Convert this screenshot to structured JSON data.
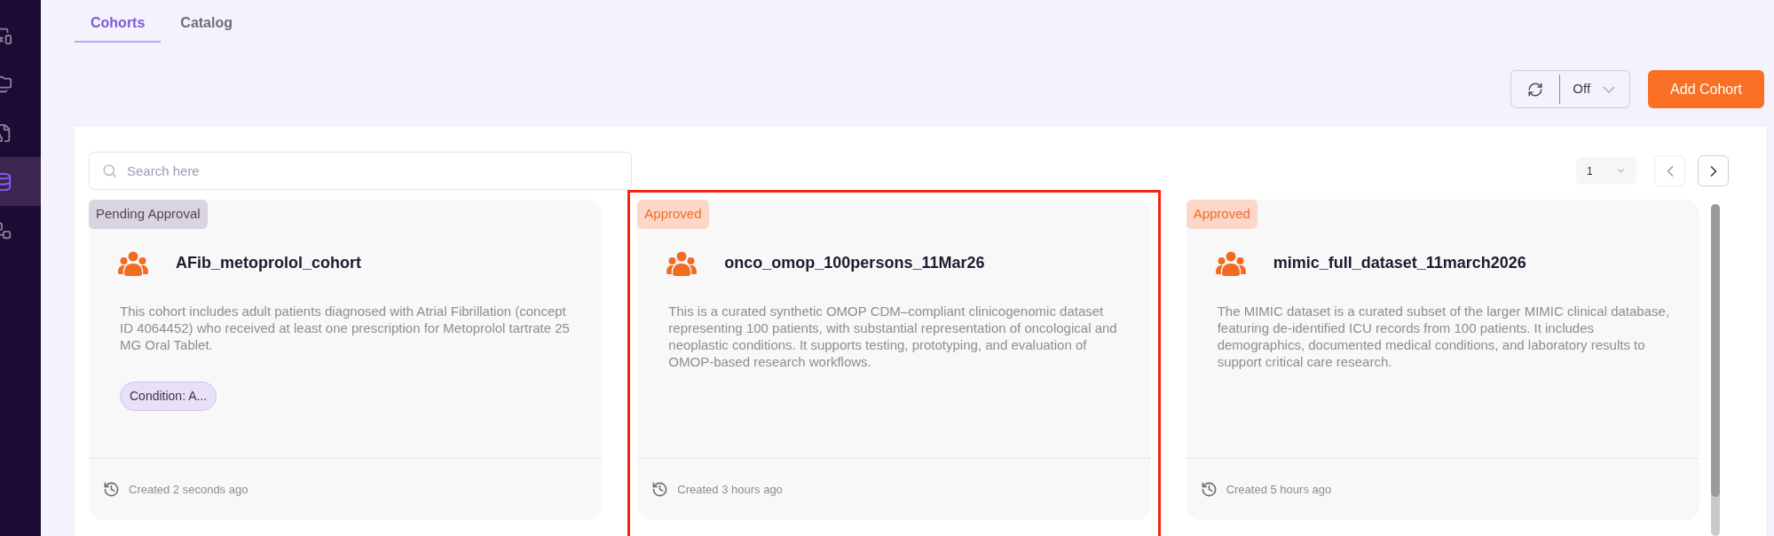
{
  "sidebar": {
    "items": [
      {
        "kind": "devices",
        "selected": false
      },
      {
        "kind": "folders",
        "selected": false
      },
      {
        "kind": "records",
        "selected": false
      },
      {
        "kind": "database",
        "selected": true
      },
      {
        "kind": "workflow",
        "selected": false
      }
    ]
  },
  "tabs": [
    {
      "label": "Cohorts",
      "selected": true
    },
    {
      "label": "Catalog",
      "selected": false
    }
  ],
  "refresh": {
    "value": "Off"
  },
  "add_button": "Add Cohort",
  "search": {
    "placeholder": "Search here"
  },
  "pagination": {
    "page": "1"
  },
  "cards": [
    {
      "status": "Pending Approval",
      "kind": "pending",
      "highlighted": false,
      "title": "AFib_metoprolol_cohort",
      "description": "This cohort includes adult patients diagnosed with Atrial Fibrillation (concept ID 4064452) who received at least one prescription for Metoprolol tartrate 25 MG Oral Tablet.",
      "tags": [
        "Condition: A..."
      ],
      "created": "Created 2 seconds ago"
    },
    {
      "status": "Approved",
      "kind": "approved",
      "highlighted": true,
      "title": "onco_omop_100persons_11Mar26",
      "description": "This is a curated synthetic OMOP CDM–compliant clinicogenomic dataset representing 100 patients, with substantial representation of oncological and neoplastic conditions. It supports testing, prototyping, and evaluation of OMOP-based research workflows.",
      "created": "Created 3 hours ago"
    },
    {
      "status": "Approved",
      "kind": "approved",
      "highlighted": false,
      "title": "mimic_full_dataset_11march2026",
      "description": "The MIMIC dataset is a curated subset of the larger MIMIC clinical database, featuring de-identified ICU records from 100 patients. It includes demographics, documented medical conditions, and laboratory results to support critical care research.",
      "created": "Created 5 hours ago"
    }
  ]
}
